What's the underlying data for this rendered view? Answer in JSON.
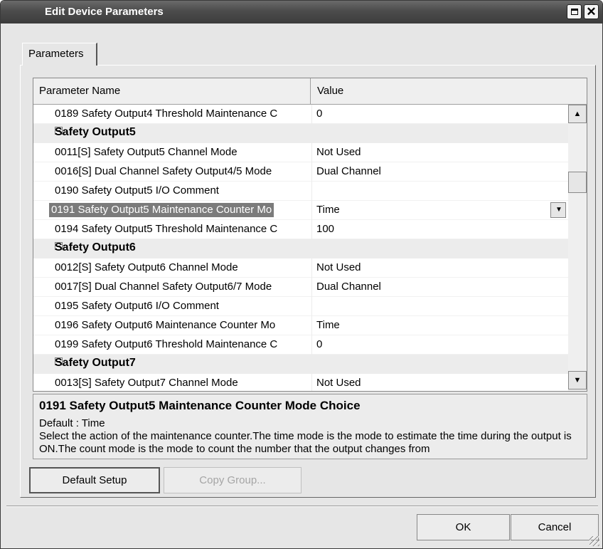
{
  "window": {
    "title": "Edit Device Parameters"
  },
  "tabs": [
    "Parameters"
  ],
  "grid": {
    "columns": [
      "Parameter Name",
      "Value"
    ],
    "rows": [
      {
        "kind": "param",
        "name": "0189 Safety Output4 Threshold Maintenance C",
        "value": "0"
      },
      {
        "kind": "group",
        "name": "Safety Output5"
      },
      {
        "kind": "param",
        "name": "0011[S] Safety Output5 Channel Mode",
        "value": "Not Used"
      },
      {
        "kind": "param",
        "name": "0016[S] Dual Channel Safety Output4/5 Mode",
        "value": "Dual Channel"
      },
      {
        "kind": "param",
        "name": "0190 Safety Output5 I/O Comment",
        "value": ""
      },
      {
        "kind": "param",
        "name": "0191 Safety Output5 Maintenance Counter Mo",
        "value": "Time",
        "selected": true
      },
      {
        "kind": "param",
        "name": "0194 Safety Output5 Threshold Maintenance C",
        "value": "100"
      },
      {
        "kind": "group",
        "name": "Safety Output6"
      },
      {
        "kind": "param",
        "name": "0012[S] Safety Output6 Channel Mode",
        "value": "Not Used"
      },
      {
        "kind": "param",
        "name": "0017[S] Dual Channel Safety Output6/7 Mode",
        "value": "Dual Channel"
      },
      {
        "kind": "param",
        "name": "0195 Safety Output6 I/O Comment",
        "value": ""
      },
      {
        "kind": "param",
        "name": "0196 Safety Output6 Maintenance Counter Mo",
        "value": "Time"
      },
      {
        "kind": "param",
        "name": "0199 Safety Output6 Threshold Maintenance C",
        "value": "0"
      },
      {
        "kind": "group",
        "name": "Safety Output7"
      },
      {
        "kind": "param",
        "name": "0013[S] Safety Output7 Channel Mode",
        "value": "Not Used"
      }
    ]
  },
  "description": {
    "title": "0191 Safety Output5 Maintenance Counter Mode Choice",
    "default": "Default : Time",
    "text": "Select the action of the maintenance counter.The time mode is the mode to estimate the time during the output is ON.The count mode is the mode to count the number that the output changes from"
  },
  "buttons": {
    "default_setup": "Default Setup",
    "copy_group": "Copy Group...",
    "ok": "OK",
    "cancel": "Cancel"
  },
  "icons": {
    "maximize": "maximize-icon",
    "close": "close-icon",
    "collapse": "collapse-icon",
    "dropdown": "chevron-down-icon",
    "scroll_up": "arrow-up-icon",
    "scroll_down": "arrow-down-icon"
  }
}
